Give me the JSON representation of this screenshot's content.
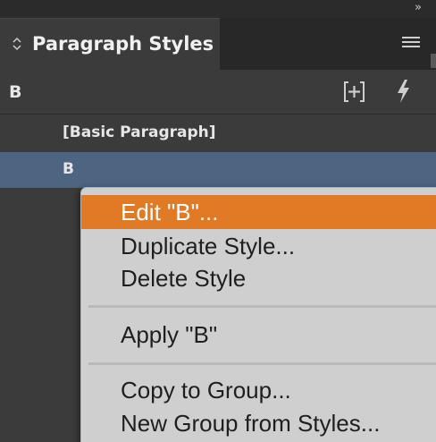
{
  "panel": {
    "title": "Paragraph Styles",
    "current_style": "B",
    "collapse_glyph": "»",
    "icons": [
      "collapse-icon",
      "tab-arrows-icon",
      "panel-menu-icon",
      "new-style-group-icon",
      "clear-overrides-icon"
    ]
  },
  "styles": {
    "items": [
      {
        "label": "[Basic Paragraph]",
        "selected": false
      },
      {
        "label": "B",
        "selected": true
      }
    ]
  },
  "context_menu": {
    "items": [
      {
        "label": "Edit \"B\"...",
        "highlighted": true
      },
      {
        "label": "Duplicate Style..."
      },
      {
        "label": "Delete Style"
      },
      {
        "label": "Apply \"B\""
      },
      {
        "label": "Copy to Group..."
      },
      {
        "label": "New Group from Styles..."
      }
    ]
  },
  "colors": {
    "panel_bg": "#3b3b3b",
    "selection": "#4e6581",
    "menu_bg": "#cfcfcf",
    "menu_highlight": "#e07a24"
  }
}
